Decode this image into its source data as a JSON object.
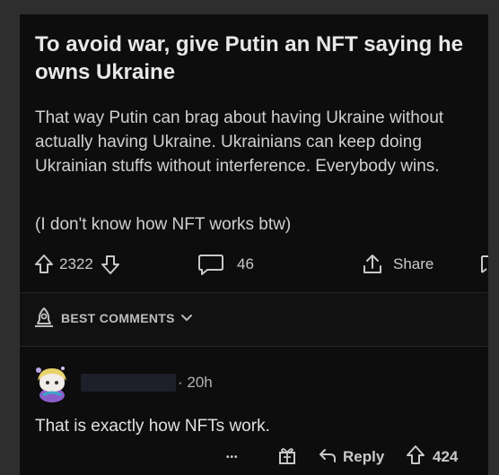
{
  "post": {
    "title": "To avoid war, give Putin an NFT saying he owns Ukraine",
    "body": "That way Putin can brag about having Ukraine without actually having Ukraine. Ukrainians can keep doing Ukrainian stuffs without interference. Everybody wins.",
    "note": "(I don't know how NFT works btw)",
    "upvotes": "2322",
    "comments_count": "46",
    "share_label": "Share"
  },
  "sort": {
    "label": "BEST COMMENTS"
  },
  "comment": {
    "time": "· 20h",
    "text": "That is exactly how NFTs work.",
    "more": "•••",
    "reply_label": "Reply",
    "upvotes": "424"
  },
  "icons": {
    "upvote": "upvote-arrow-icon",
    "downvote": "downvote-arrow-icon",
    "comment": "comment-bubble-icon",
    "share": "share-icon",
    "best": "rocket-icon",
    "award": "gift-icon",
    "reply": "reply-arrow-icon"
  },
  "colors": {
    "background": "#0d0d0d",
    "text": "#d7dadc",
    "muted": "#b4b4b4"
  }
}
